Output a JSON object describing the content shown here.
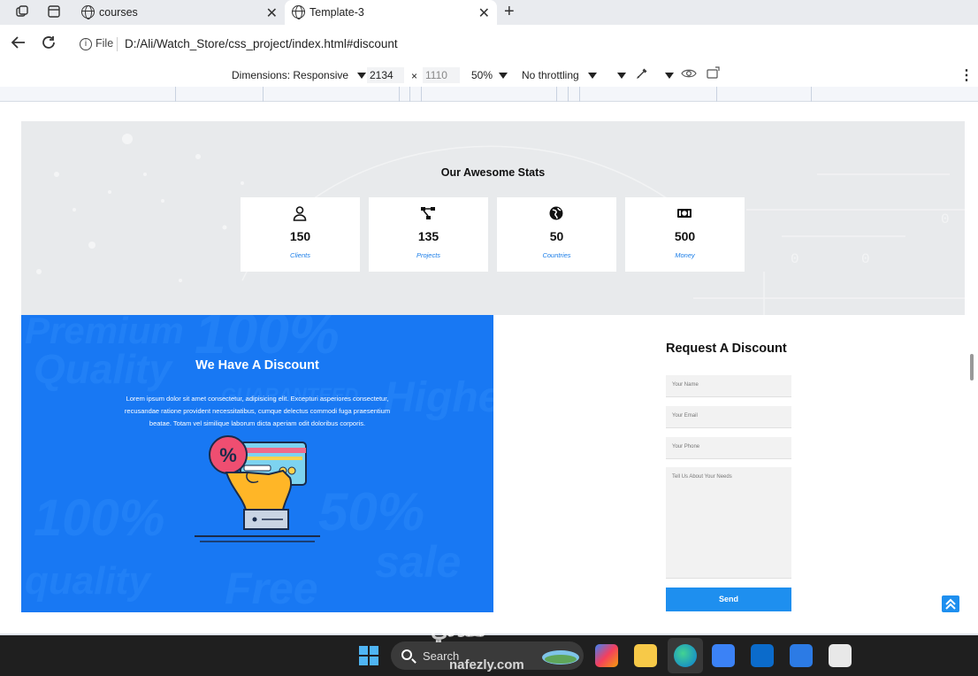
{
  "browser": {
    "tabs": [
      {
        "title": "courses",
        "active": false
      },
      {
        "title": "Template-3",
        "active": true
      }
    ],
    "address": {
      "chip": "File",
      "url": "D:/Ali/Watch_Store/css_project/index.html#discount"
    }
  },
  "devtools": {
    "dimensions_label": "Dimensions: Responsive",
    "width_value": "2134",
    "times": "×",
    "height_value": "1110",
    "zoom": "50%",
    "throttling": "No throttling"
  },
  "stats": {
    "title": "Our Awesome Stats",
    "items": [
      {
        "icon": "user-icon",
        "number": "150",
        "label": "Clients"
      },
      {
        "icon": "project-diagram-icon",
        "number": "135",
        "label": "Projects"
      },
      {
        "icon": "globe-icon",
        "number": "50",
        "label": "Countries"
      },
      {
        "icon": "money-bill-icon",
        "number": "500",
        "label": "Money"
      }
    ]
  },
  "discount": {
    "title": "We Have A Discount",
    "text": "Lorem ipsum dolor sit amet consectetur, adipisicing elit. Excepturi asperiores consectetur, recusandae ratione provident necessitatibus, cumque delectus commodi fuga praesentium beatae. Totam vel similique laborum dicta aperiam odit doloribus corporis.",
    "bg_words": [
      "Premium",
      "Quality",
      "100%",
      "GUARANTEED",
      "Highe",
      "100%",
      "quality",
      "50%",
      "Free",
      "sale"
    ]
  },
  "form": {
    "title": "Request A Discount",
    "name_placeholder": "Your Name",
    "email_placeholder": "Your Email",
    "phone_placeholder": "Your Phone",
    "needs_placeholder": "Tell Us About Your Needs",
    "send_label": "Send"
  },
  "taskbar": {
    "search_label": "Search"
  },
  "watermark": {
    "main": "نفذلي",
    "sub": "nafezly.com"
  },
  "colors": {
    "accent_blue": "#1878f3",
    "button_blue": "#1e8fef",
    "label_blue": "#1a7de8"
  }
}
